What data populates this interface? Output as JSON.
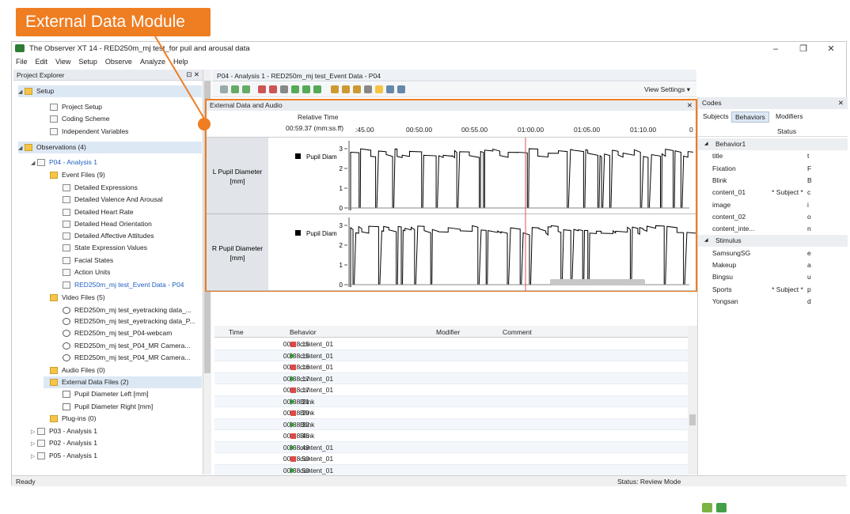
{
  "callout": {
    "label": "External Data Module"
  },
  "window": {
    "title": "The Observer XT 14 - RED250m_mj test_for puil and arousal data"
  },
  "menu": [
    "File",
    "Edit",
    "View",
    "Setup",
    "Observe",
    "Analyze",
    "Help"
  ],
  "project_explorer": {
    "title": "Project Explorer",
    "rows": [
      {
        "indent": 0,
        "tog": "◢",
        "icon": "fold",
        "label": "Setup",
        "cls": "sel"
      },
      {
        "indent": 2,
        "tog": "",
        "icon": "doc",
        "label": "Project Setup"
      },
      {
        "indent": 2,
        "tog": "",
        "icon": "doc",
        "label": "Coding Scheme"
      },
      {
        "indent": 2,
        "tog": "",
        "icon": "doc",
        "label": "Independent Variables"
      },
      {
        "indent": 0,
        "tog": "◢",
        "icon": "fold",
        "label": "Observations (4)",
        "cls": "sel"
      },
      {
        "indent": 1,
        "tog": "◢",
        "icon": "doc",
        "label": "P04 - Analysis 1",
        "cls": "link"
      },
      {
        "indent": 2,
        "tog": "",
        "icon": "fold",
        "label": "Event Files (9)"
      },
      {
        "indent": 3,
        "tog": "",
        "icon": "doc",
        "label": "Detailed Expressions"
      },
      {
        "indent": 3,
        "tog": "",
        "icon": "doc",
        "label": "Detailed Valence And Arousal"
      },
      {
        "indent": 3,
        "tog": "",
        "icon": "doc",
        "label": "Detailed Heart Rate"
      },
      {
        "indent": 3,
        "tog": "",
        "icon": "doc",
        "label": "Detailed Head Orientation"
      },
      {
        "indent": 3,
        "tog": "",
        "icon": "doc",
        "label": "Detailed Affective Attitudes"
      },
      {
        "indent": 3,
        "tog": "",
        "icon": "doc",
        "label": "State Expression Values"
      },
      {
        "indent": 3,
        "tog": "",
        "icon": "doc",
        "label": "Facial States"
      },
      {
        "indent": 3,
        "tog": "",
        "icon": "doc",
        "label": "Action Units"
      },
      {
        "indent": 3,
        "tog": "",
        "icon": "doc",
        "label": "RED250m_mj test_Event Data - P04",
        "cls": "link"
      },
      {
        "indent": 2,
        "tog": "",
        "icon": "fold",
        "label": "Video Files (5)"
      },
      {
        "indent": 3,
        "tog": "",
        "icon": "play",
        "label": "RED250m_mj test_eyetracking data_..."
      },
      {
        "indent": 3,
        "tog": "",
        "icon": "play",
        "label": "RED250m_mj test_eyetracking data_P..."
      },
      {
        "indent": 3,
        "tog": "",
        "icon": "play",
        "label": "RED250m_mj test_P04-webcam"
      },
      {
        "indent": 3,
        "tog": "",
        "icon": "play",
        "label": "RED250m_mj test_P04_MR Camera..."
      },
      {
        "indent": 3,
        "tog": "",
        "icon": "play",
        "label": "RED250m_mj test_P04_MR Camera..."
      },
      {
        "indent": 2,
        "tog": "",
        "icon": "fold",
        "label": "Audio Files (0)"
      },
      {
        "indent": 2,
        "tog": "",
        "icon": "fold",
        "label": "External Data Files (2)",
        "cls": "sel"
      },
      {
        "indent": 3,
        "tog": "",
        "icon": "chart",
        "label": "Pupil Diameter Left [mm]"
      },
      {
        "indent": 3,
        "tog": "",
        "icon": "chart",
        "label": "Pupil Diameter Right [mm]"
      },
      {
        "indent": 2,
        "tog": "",
        "icon": "fold",
        "label": "Plug-ins (0)"
      },
      {
        "indent": 1,
        "tog": "▷",
        "icon": "doc",
        "label": "P03 - Analysis 1"
      },
      {
        "indent": 1,
        "tog": "▷",
        "icon": "doc",
        "label": "P02 - Analysis 1"
      },
      {
        "indent": 1,
        "tog": "▷",
        "icon": "doc",
        "label": "P05 - Analysis 1"
      }
    ]
  },
  "document_tab": "P04 - Analysis 1 - RED250m_mj test_Event Data - P04",
  "toolbar": {
    "view_settings": "View Settings"
  },
  "external_panel": {
    "title": "External Data and Audio",
    "relative_time_label": "Relative Time",
    "current_time": "00:59.37 (mm:ss.ff)",
    "ticks": [
      ":45.00",
      "00:50.00",
      "00:55.00",
      "01:00.00",
      "01:05.00",
      "01:10.00",
      "0"
    ],
    "tracks": [
      {
        "label": "L Pupil Diameter [mm]",
        "legend": "Pupil Diam",
        "yticks": [
          "3",
          "2",
          "1",
          "0"
        ]
      },
      {
        "label": "R Pupil Diameter [mm]",
        "legend": "Pupil Diam",
        "yticks": [
          "3",
          "2",
          "1",
          "0"
        ]
      }
    ]
  },
  "codes": {
    "title": "Codes",
    "tabs": [
      "Subjects",
      "Behaviors",
      "Modifiers"
    ],
    "status_header": "Status",
    "rows": [
      {
        "g": true,
        "n": "Behavior1",
        "s": "",
        "k": ""
      },
      {
        "n": "title",
        "s": "",
        "k": "t"
      },
      {
        "n": "Fixation",
        "s": "",
        "k": "F"
      },
      {
        "n": "Blink",
        "s": "",
        "k": "B"
      },
      {
        "n": "content_01",
        "s": "* Subject *",
        "k": "c"
      },
      {
        "n": "image",
        "s": "",
        "k": "i"
      },
      {
        "n": "content_02",
        "s": "",
        "k": "o"
      },
      {
        "n": "content_inte...",
        "s": "",
        "k": "n"
      },
      {
        "g": true,
        "n": "Stimulus",
        "s": "",
        "k": ""
      },
      {
        "n": "SamsungSG",
        "s": "",
        "k": "e"
      },
      {
        "n": "Makeup",
        "s": "",
        "k": "a"
      },
      {
        "n": "Bingsu",
        "s": "",
        "k": "u"
      },
      {
        "n": "Sports",
        "s": "* Subject *",
        "k": "p"
      },
      {
        "n": "Yongsan",
        "s": "",
        "k": "d"
      }
    ]
  },
  "events": {
    "headers": [
      "Time",
      "Behavior",
      "Modifier",
      "Comment"
    ],
    "rows": [
      {
        "t": "00:38.15",
        "m": "stop",
        "b": "content_01"
      },
      {
        "t": "00:38.15",
        "m": "start",
        "b": "content_01"
      },
      {
        "t": "00:38.16",
        "m": "stop",
        "b": "content_01"
      },
      {
        "t": "00:38.17",
        "m": "start",
        "b": "content_01"
      },
      {
        "t": "00:38.17",
        "m": "stop",
        "b": "content_01"
      },
      {
        "t": "00:38.21",
        "m": "start",
        "b": "Blink"
      },
      {
        "t": "00:38.29",
        "m": "stop",
        "b": "Blink"
      },
      {
        "t": "00:38.32",
        "m": "start",
        "b": "Blink"
      },
      {
        "t": "00:38.45",
        "m": "stop",
        "b": "Blink"
      },
      {
        "t": "00:38.49",
        "m": "start",
        "b": "content_01"
      },
      {
        "t": "00:38.50",
        "m": "stop",
        "b": "content_01"
      },
      {
        "t": "00:38.50",
        "m": "start",
        "b": "content_01"
      }
    ]
  },
  "status": {
    "left": "Ready",
    "right": "Status: Review Mode"
  }
}
